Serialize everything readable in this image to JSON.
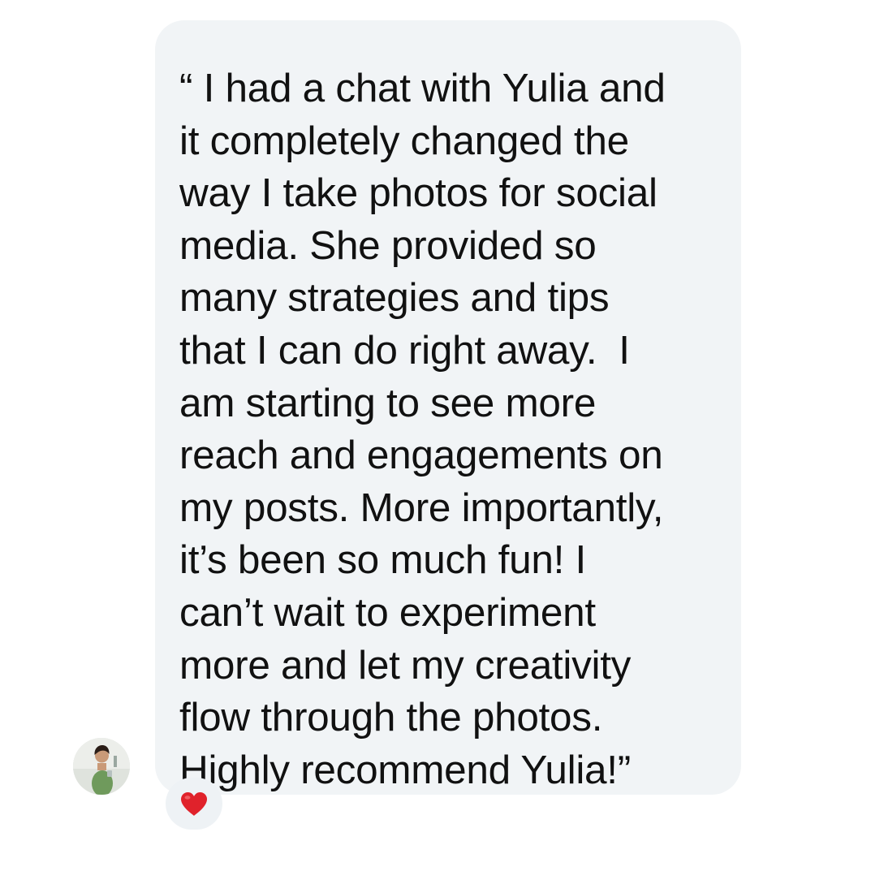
{
  "message": {
    "lines": [
      "“ I had a chat with Yulia and",
      "it completely changed the",
      "way I take photos for social",
      "media. She provided so",
      "many strategies and tips",
      "that I can do right away.  I",
      "am starting to see more",
      "reach and engagements on",
      "my posts. More importantly,",
      "it’s been so much fun! I",
      "can’t wait to experiment",
      "more and let my creativity",
      "flow through the photos.",
      "Highly recommend Yulia!”"
    ],
    "bubble_color": "#f1f4f6",
    "text_color": "#111111"
  },
  "sender": {
    "avatar_icon": "profile-photo-avatar"
  },
  "reaction": {
    "icon": "red-heart-icon",
    "color": "#e0222b"
  }
}
